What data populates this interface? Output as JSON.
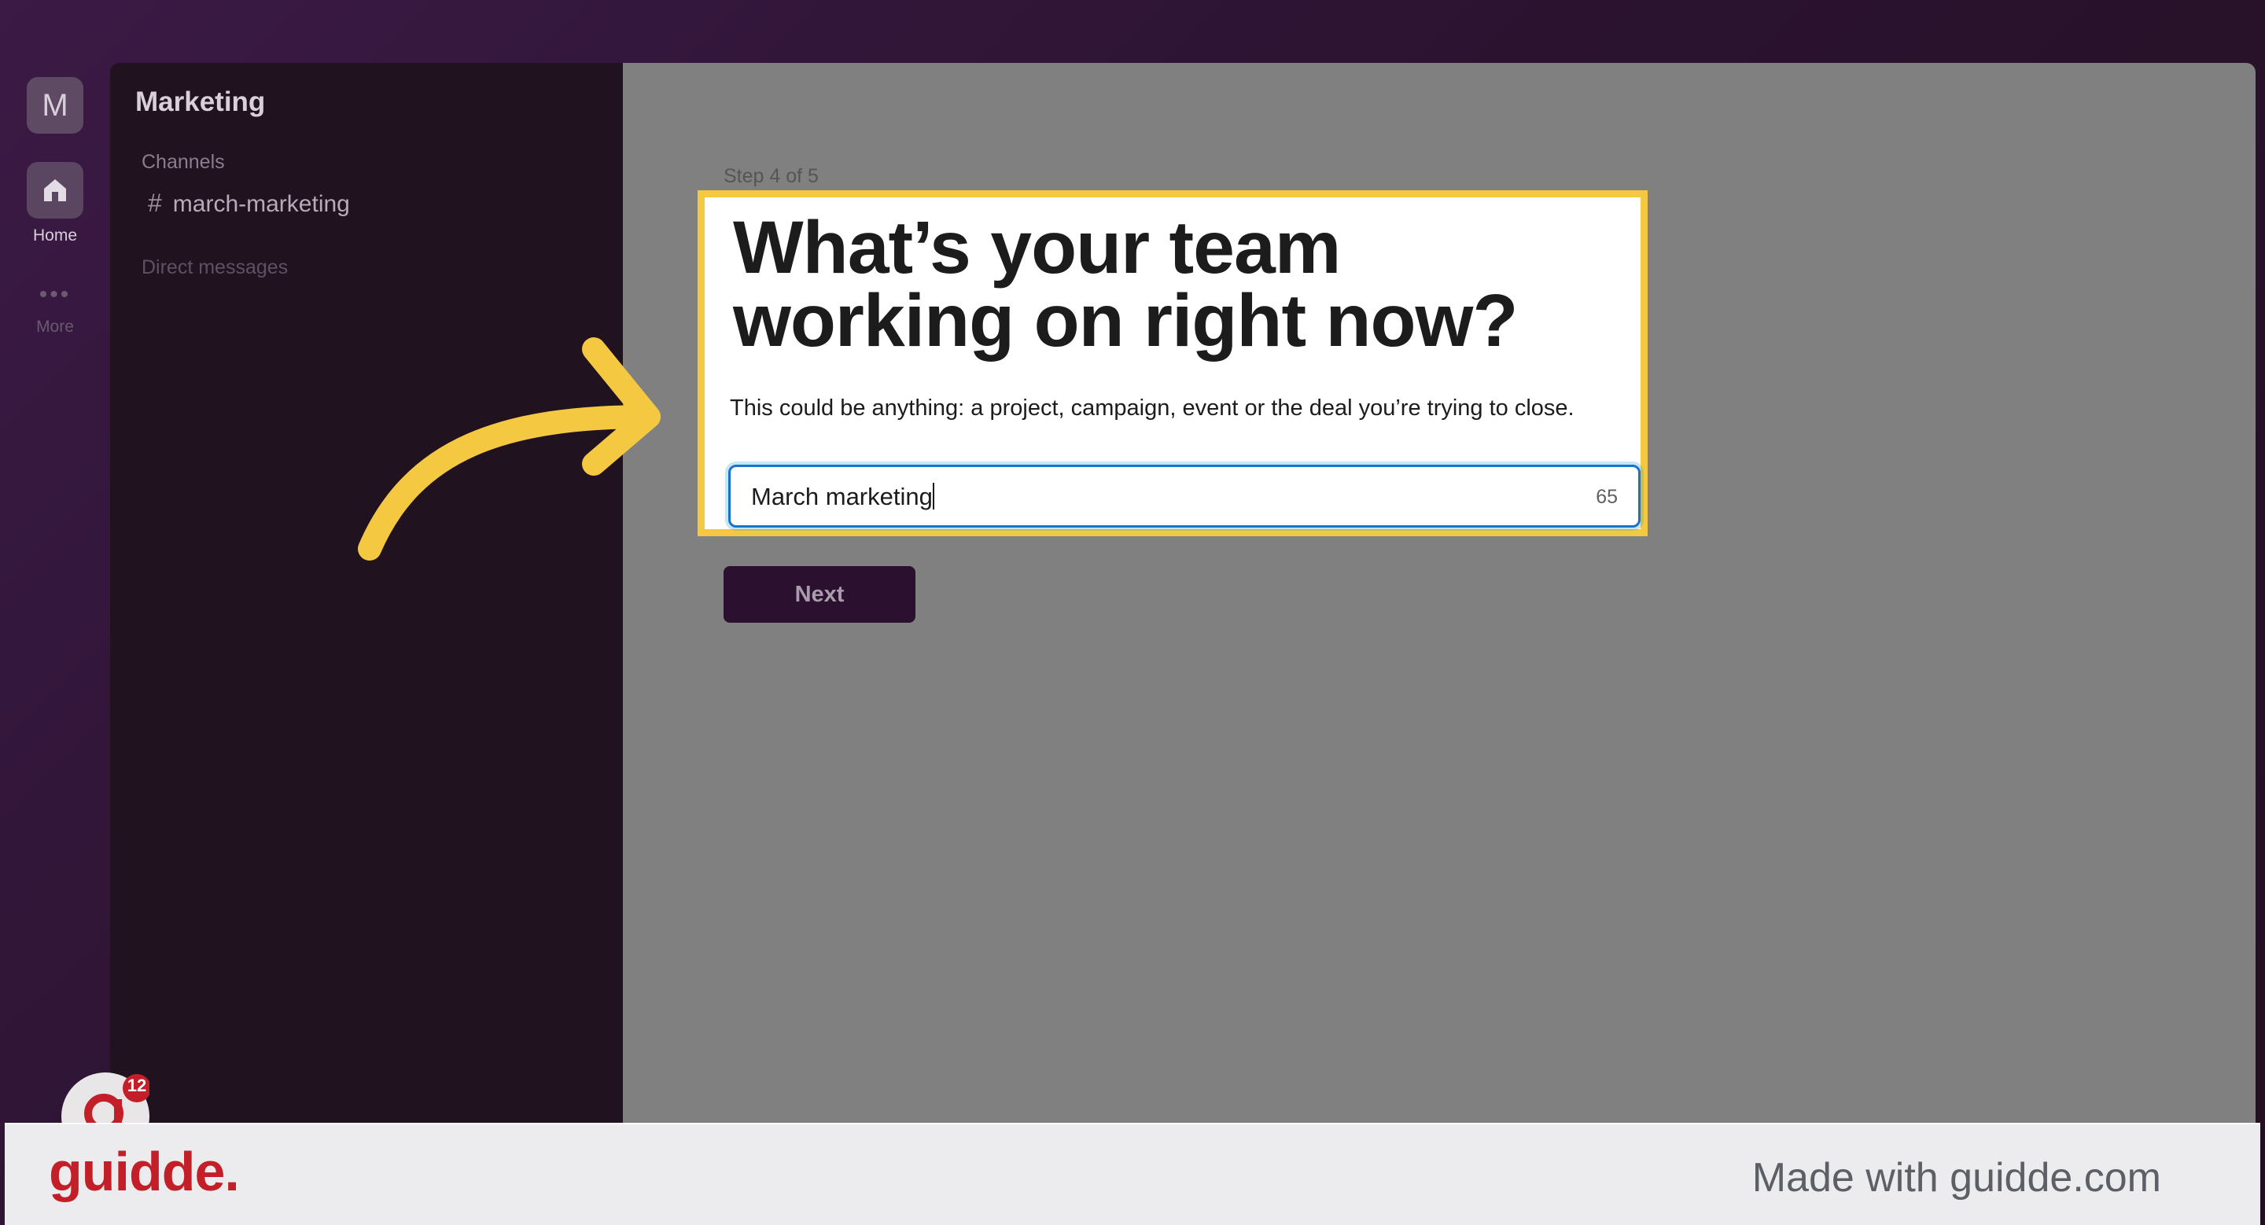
{
  "rail": {
    "workspace_initial": "M",
    "home_label": "Home",
    "more_dots": "•••",
    "more_label": "More",
    "icons": {
      "home": "home-icon",
      "more": "ellipsis-icon"
    }
  },
  "sidebar": {
    "workspace_name": "Marketing",
    "channels_label": "Channels",
    "channels": [
      {
        "hash": "#",
        "name": "march-marketing"
      }
    ],
    "dm_label": "Direct messages"
  },
  "dialog": {
    "step": "Step 4 of 5",
    "headline": "What’s your team working on right now?",
    "description": "This could be anything: a project, campaign, event or the deal you’re trying to close.",
    "input_value": "March marketing",
    "char_counter": "65",
    "next_label": "Next"
  },
  "overlay": {
    "highlight_color": "#f5c842",
    "arrow_color": "#f5c842"
  },
  "footer": {
    "logo": "guidde.",
    "made_with": "Made with guidde.com",
    "badge_count": "12",
    "brand_color": "#c31f28"
  }
}
